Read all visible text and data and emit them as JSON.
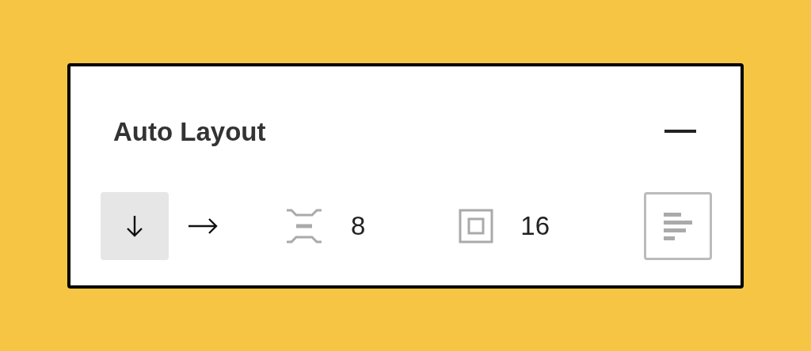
{
  "panel": {
    "title": "Auto Layout",
    "directions": [
      {
        "kind": "vertical",
        "selected": true
      },
      {
        "kind": "horizontal",
        "selected": false
      }
    ],
    "spacing": {
      "value": "8"
    },
    "padding": {
      "value": "16"
    }
  }
}
